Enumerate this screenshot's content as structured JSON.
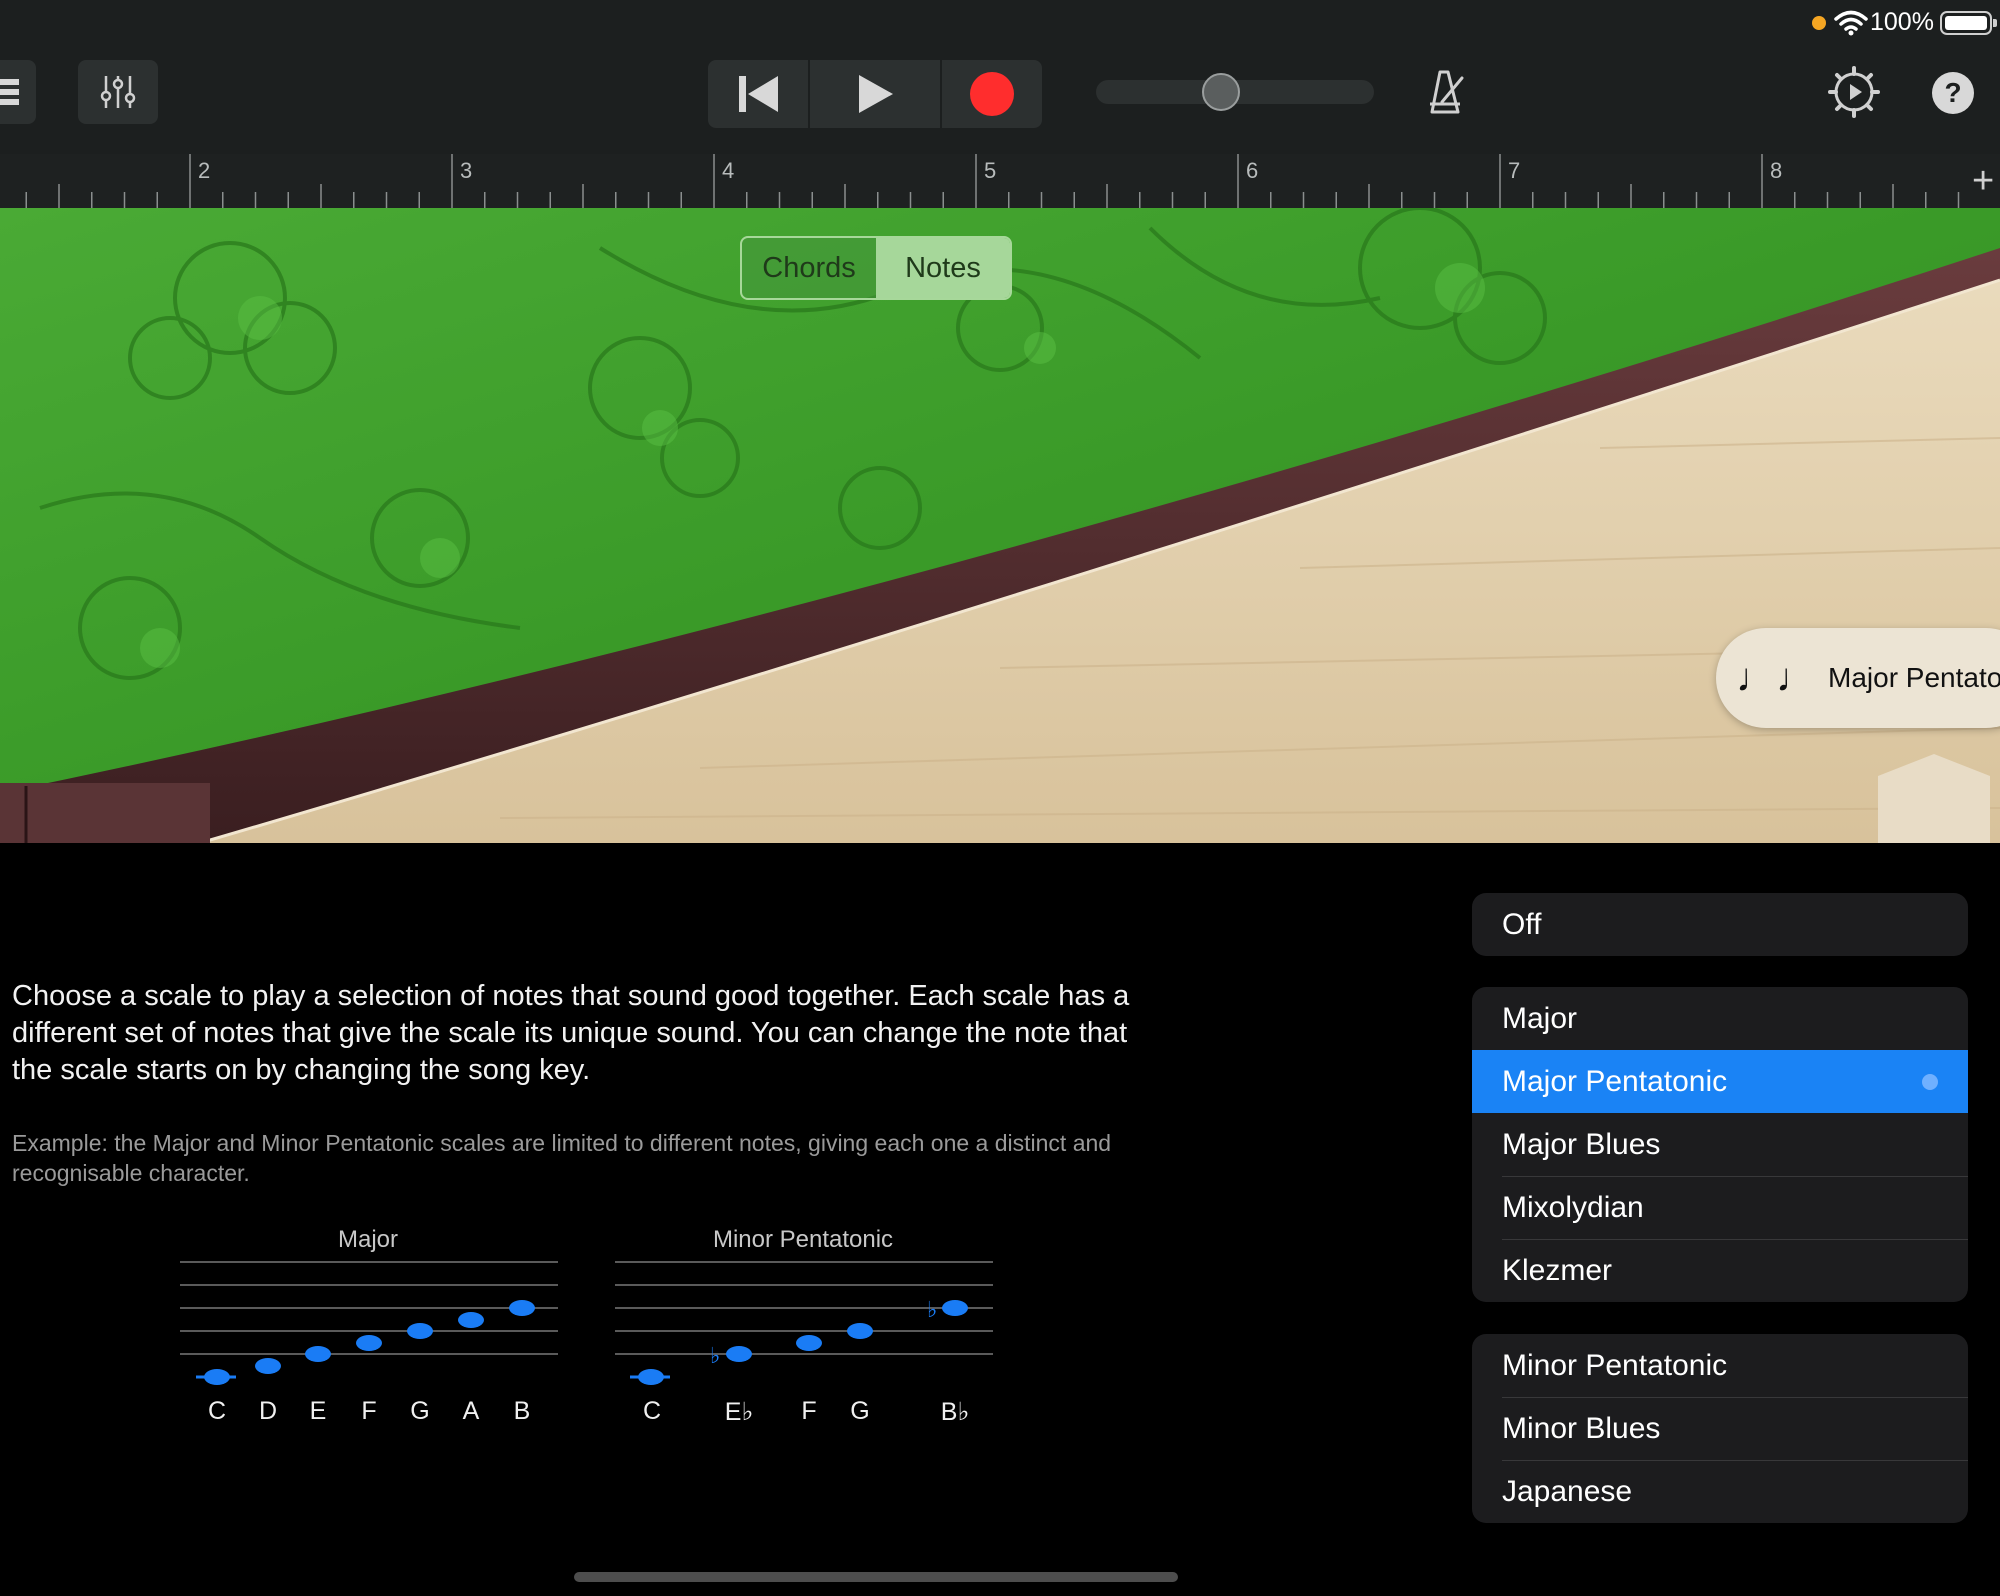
{
  "status_bar": {
    "battery_percent": "100%",
    "icons": [
      "recording-indicator-dot",
      "wifi-icon",
      "battery-icon"
    ]
  },
  "toolbar": {
    "icons": [
      "tracks-view-icon",
      "mixer-icon",
      "rewind-icon",
      "play-icon",
      "record-icon",
      "metronome-icon",
      "settings-icon",
      "help-icon"
    ],
    "help_label": "?",
    "record_color": "#ff2d2d",
    "volume_level": 0.35
  },
  "ruler": {
    "bar_numbers": [
      "2",
      "3",
      "4",
      "5",
      "6",
      "7",
      "8"
    ],
    "add_label": "+"
  },
  "instrument": {
    "mode_toggle": {
      "chords_label": "Chords",
      "notes_label": "Notes",
      "active": "Notes"
    },
    "scale_pill": {
      "icon": "notes-icon",
      "icon_glyph": "♩♩",
      "label": "Major Pentatonic"
    },
    "colors": {
      "silk_green": "#3e9a2c",
      "wood": "#e2d0b1",
      "rail": "#4a2a2c"
    }
  },
  "help": {
    "paragraph": "Choose a scale to play a selection of notes that sound good together. Each scale has a different set of notes that give the scale its unique sound. You can change the note that the scale starts on by changing the song key.",
    "example": "Example: the Major and Minor Pentatonic scales are limited to different notes, giving each one a distinct and recognisable character.",
    "staffs": [
      {
        "title": "Major",
        "notes": [
          "C",
          "D",
          "E",
          "F",
          "G",
          "A",
          "B"
        ]
      },
      {
        "title": "Minor Pentatonic",
        "notes": [
          "C",
          "E♭",
          "F",
          "G",
          "B♭"
        ]
      }
    ]
  },
  "scale_list": {
    "off_label": "Off",
    "group1": [
      "Major",
      "Major Pentatonic",
      "Major Blues",
      "Mixolydian",
      "Klezmer"
    ],
    "group2": [
      "Minor Pentatonic",
      "Minor Blues",
      "Japanese"
    ],
    "selected": "Major Pentatonic",
    "selected_color": "#1a83f5"
  }
}
